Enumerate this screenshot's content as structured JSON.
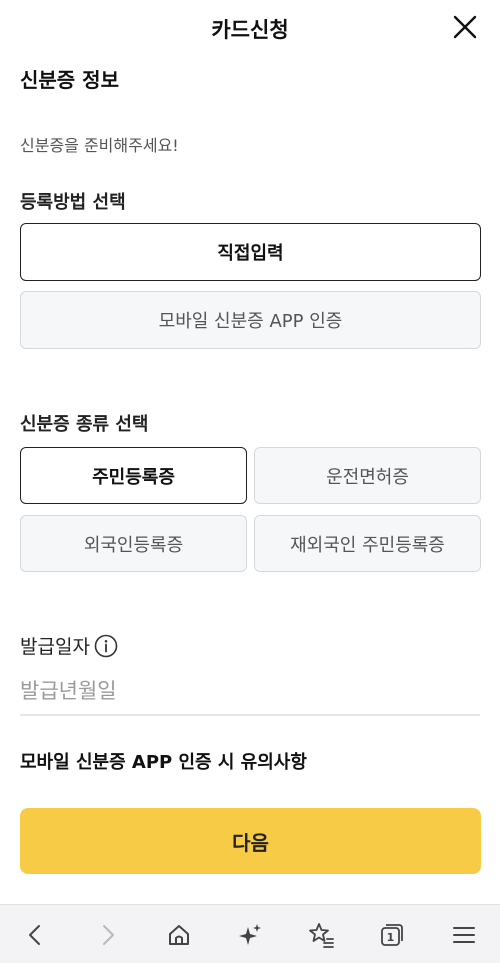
{
  "header": {
    "title": "카드신청"
  },
  "id_section": {
    "title": "신분증 정보",
    "hint": "신분증을 준비해주세요!"
  },
  "method": {
    "label": "등록방법 선택",
    "options": [
      "직접입력",
      "모바일 신분증 APP 인증"
    ],
    "selected": "직접입력"
  },
  "id_type": {
    "label": "신분증 종류 선택",
    "options": [
      "주민등록증",
      "운전면허증",
      "외국인등록증",
      "재외국인 주민등록증"
    ],
    "selected": "주민등록증"
  },
  "issue_date": {
    "label": "발급일자",
    "placeholder": "발급년월일",
    "value": ""
  },
  "notice": {
    "title": "모바일 신분증 APP 인증 시 유의사항"
  },
  "next_button": {
    "label": "다음"
  },
  "colors": {
    "accent": "#f7cb45",
    "selected_border": "#222222",
    "option_bg": "#f6f7f9"
  },
  "bottom_nav": {
    "icons": [
      "back-icon",
      "forward-icon",
      "home-icon",
      "sparkle-icon",
      "bookmark-star-icon",
      "tabs-icon",
      "menu-icon"
    ],
    "tab_count": "1"
  }
}
